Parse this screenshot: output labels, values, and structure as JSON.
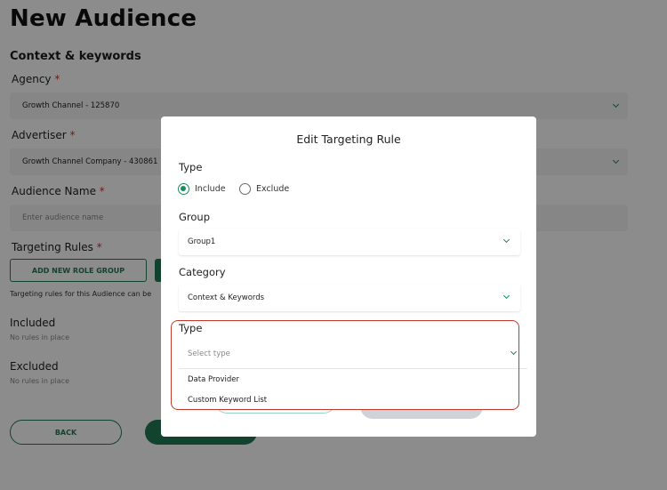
{
  "page": {
    "title": "New Audience",
    "section_title": "Context & keywords"
  },
  "form": {
    "agency_label": "Agency",
    "agency_value": "Growth Channel - 125870",
    "advertiser_label": "Advertiser",
    "advertiser_value": "Growth Channel Company - 430861",
    "audience_name_label": "Audience Name",
    "audience_name_placeholder": "Enter audience name",
    "targeting_rules_label": "Targeting Rules",
    "add_role_group_label": "ADD NEW ROLE GROUP",
    "targeting_note": "Targeting rules for this Audience can be",
    "included_label": "Included",
    "included_empty": "No rules in place",
    "excluded_label": "Excluded",
    "excluded_empty": "No rules in place",
    "back_label": "BACK",
    "required_mark": "*"
  },
  "modal": {
    "title": "Edit Targeting Rule",
    "type_label": "Type",
    "radio_include": "Include",
    "radio_exclude": "Exclude",
    "selected_radio": "Include",
    "group_label": "Group",
    "group_value": "Group1",
    "category_label": "Category",
    "category_value": "Context & Keywords",
    "type2_label": "Type",
    "type2_placeholder": "Select type",
    "options": [
      "Data Provider",
      "Custom Keyword List"
    ]
  },
  "colors": {
    "accent": "#1f7a55",
    "highlight": "#c0392b",
    "required": "#d0342c"
  },
  "icons": {
    "dropdown": "chevron-down-icon"
  }
}
